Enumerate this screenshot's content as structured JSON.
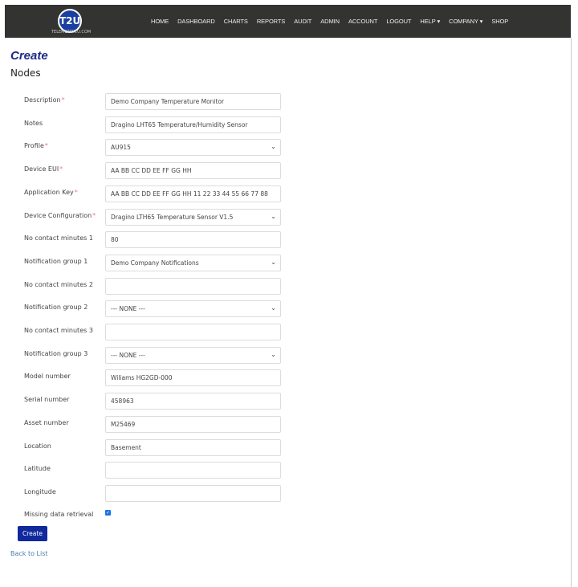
{
  "nav": {
    "logo_text": "T2U",
    "logo_sub": "TELEMETRY2U.COM",
    "items": [
      "HOME",
      "DASHBOARD",
      "CHARTS",
      "REPORTS",
      "AUDIT",
      "ADMIN",
      "ACCOUNT",
      "LOGOUT",
      "HELP ▾",
      "COMPANY ▾",
      "SHOP"
    ]
  },
  "page": {
    "title": "Create",
    "subtitle": "Nodes"
  },
  "fields": [
    {
      "label": "Description",
      "required": true,
      "type": "text",
      "value": "Demo Company Temperature Monitor"
    },
    {
      "label": "Notes",
      "required": false,
      "type": "text",
      "value": "Dragino LHT65 Temperature/Humidity Sensor"
    },
    {
      "label": "Profile",
      "required": true,
      "type": "select",
      "value": "AU915"
    },
    {
      "label": "Device EUI",
      "required": true,
      "type": "text",
      "value": "AA BB CC DD EE FF GG HH"
    },
    {
      "label": "Application Key",
      "required": true,
      "type": "text",
      "value": "AA BB CC DD EE FF GG HH 11 22 33 44 55 66 77 88"
    },
    {
      "label": "Device Configuration",
      "required": true,
      "type": "select",
      "value": "Dragino LTH65 Temperature Sensor V1.5"
    },
    {
      "label": "No contact minutes 1",
      "required": false,
      "type": "text",
      "value": "80"
    },
    {
      "label": "Notification group 1",
      "required": false,
      "type": "select",
      "value": "Demo Company Notifications"
    },
    {
      "label": "No contact minutes 2",
      "required": false,
      "type": "text",
      "value": ""
    },
    {
      "label": "Notification group 2",
      "required": false,
      "type": "select",
      "value": "--- NONE ---"
    },
    {
      "label": "No contact minutes 3",
      "required": false,
      "type": "text",
      "value": ""
    },
    {
      "label": "Notification group 3",
      "required": false,
      "type": "select",
      "value": "--- NONE ---"
    },
    {
      "label": "Model number",
      "required": false,
      "type": "text",
      "value": "Wiliams HG2GD-000"
    },
    {
      "label": "Serial number",
      "required": false,
      "type": "text",
      "value": "458963"
    },
    {
      "label": "Asset number",
      "required": false,
      "type": "text",
      "value": "M25469"
    },
    {
      "label": "Location",
      "required": false,
      "type": "text",
      "value": "Basement"
    },
    {
      "label": "Latitude",
      "required": false,
      "type": "text",
      "value": ""
    },
    {
      "label": "Longitude",
      "required": false,
      "type": "text",
      "value": ""
    }
  ],
  "missing_data": {
    "label": "Missing data retrieval",
    "checked": true
  },
  "create_label": "Create",
  "back_label": "Back to List",
  "required_mark": "*"
}
